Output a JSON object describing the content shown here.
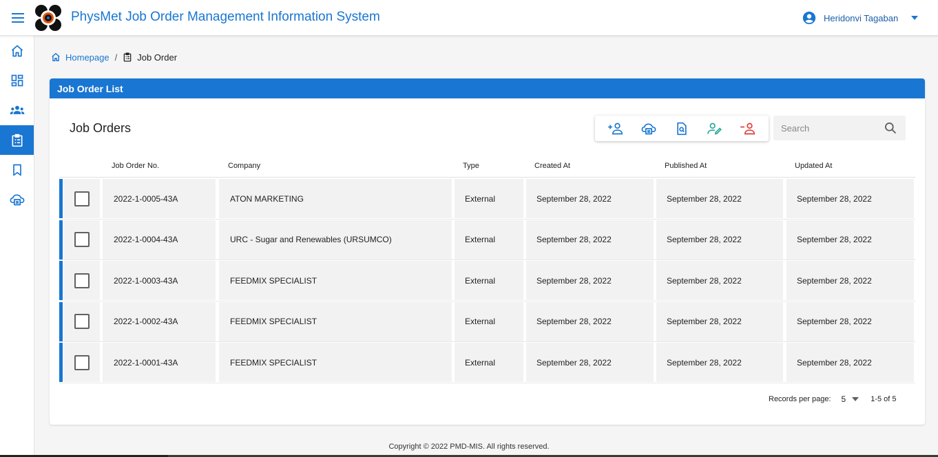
{
  "header": {
    "app_title": "PhysMet Job Order Management Information System",
    "user_name": "Heridonvi Tagaban"
  },
  "sidebar": {
    "items": [
      {
        "icon": "home-icon"
      },
      {
        "icon": "dashboard-icon"
      },
      {
        "icon": "users-icon"
      },
      {
        "icon": "job-order-clipboard-icon",
        "active": true
      },
      {
        "icon": "bookmark-icon"
      },
      {
        "icon": "cloud-print-icon"
      }
    ]
  },
  "breadcrumb": {
    "home": "Homepage",
    "separator": "/",
    "current": "Job Order"
  },
  "card": {
    "header": "Job Order List",
    "section_title": "Job Orders",
    "search_placeholder": "Search"
  },
  "toolbar": {
    "buttons": [
      "add-person-icon",
      "cloud-print-icon",
      "document-search-icon",
      "edit-person-icon",
      "remove-person-icon"
    ]
  },
  "table": {
    "columns": [
      "Job Order No.",
      "Company",
      "Type",
      "Created At",
      "Published At",
      "Updated At"
    ],
    "rows": [
      {
        "no": "2022-1-0005-43A",
        "company": "ATON MARKETING",
        "type": "External",
        "created": "September 28, 2022",
        "published": "September 28, 2022",
        "updated": "September 28, 2022"
      },
      {
        "no": "2022-1-0004-43A",
        "company": "URC - Sugar and Renewables (URSUMCO)",
        "type": "External",
        "created": "September 28, 2022",
        "published": "September 28, 2022",
        "updated": "September 28, 2022"
      },
      {
        "no": "2022-1-0003-43A",
        "company": "FEEDMIX SPECIALIST",
        "type": "External",
        "created": "September 28, 2022",
        "published": "September 28, 2022",
        "updated": "September 28, 2022"
      },
      {
        "no": "2022-1-0002-43A",
        "company": "FEEDMIX SPECIALIST",
        "type": "External",
        "created": "September 28, 2022",
        "published": "September 28, 2022",
        "updated": "September 28, 2022"
      },
      {
        "no": "2022-1-0001-43A",
        "company": "FEEDMIX SPECIALIST",
        "type": "External",
        "created": "September 28, 2022",
        "published": "September 28, 2022",
        "updated": "September 28, 2022"
      }
    ]
  },
  "pagination": {
    "records_per_page_label": "Records per page:",
    "records_per_page": "5",
    "range": "1-5 of 5"
  },
  "footer": {
    "copyright": "Copyright © 2022 PMD-MIS. All rights reserved."
  },
  "colors": {
    "primary": "#1976d2",
    "add": "#1976d2",
    "edit": "#26a69a",
    "remove": "#e53935"
  }
}
